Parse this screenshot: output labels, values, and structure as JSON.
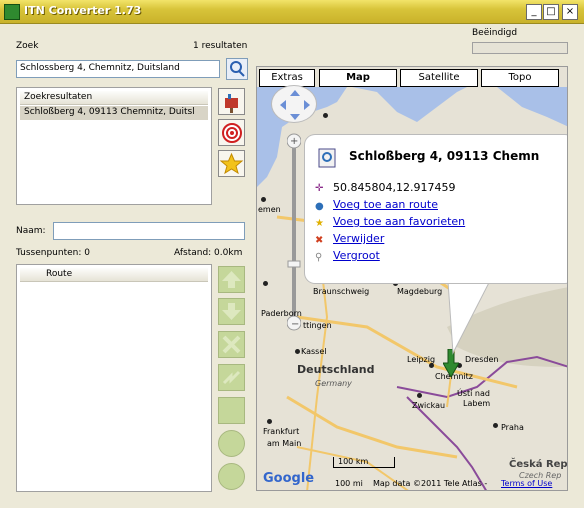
{
  "window": {
    "title": "ITN Converter 1.73",
    "minimize": "_",
    "maximize": "□",
    "close": "×"
  },
  "search": {
    "label": "Zoek",
    "result_count": "1 resultaten",
    "value": "Schlossberg 4, Chemnitz, Duitsland",
    "status": "Beëindigd"
  },
  "results": {
    "header": "Zoekresultaten",
    "items": [
      "Schloßberg 4, 09113 Chemnitz, Duitsl"
    ]
  },
  "name": {
    "label": "Naam:",
    "value": ""
  },
  "route_info": {
    "waypoints": "Tussenpunten: 0",
    "distance": "Afstand: 0.0km",
    "header": "Route"
  },
  "map": {
    "tabs": [
      "Extras",
      "Map",
      "Satellite",
      "Topo"
    ],
    "active_tab": "Map",
    "popup": {
      "title": "Schloßberg 4, 09113 Chemn",
      "coords": "50.845804,12.917459",
      "add_route": "Voeg toe aan route",
      "add_fav": "Voeg toe aan favorieten",
      "remove": "Verwijder",
      "zoom": "Vergroot"
    },
    "places": {
      "braunschweig": "Braunschweig",
      "magdeburg": "Magdeburg",
      "paderborn": "Paderborn",
      "gottingen": "ttingen",
      "kassel": "Kassel",
      "deutschland": "Deutschland",
      "germany": "Germany",
      "leipzig": "Leipzig",
      "dresden": "Dresden",
      "chemnitz": "Chemnitz",
      "zwickau": "Zwickau",
      "ustinad": "Ústí nad",
      "labem": "Labem",
      "frankfurt": "Frankfurt",
      "amMain": "am Main",
      "praha": "Praha",
      "ceska": "Česká Rep",
      "czech": "Czech Rep",
      "emen": "emen"
    },
    "scale_top": "100 km",
    "scale_bottom": "100 mi",
    "attrib": "Map data ©2011 Tele Atlas -",
    "terms": "Terms of Use",
    "logo": "Google",
    "colors": {
      "water": "#a9c0e8",
      "land": "#e6e2d6",
      "border": "#8a4b9a"
    }
  }
}
